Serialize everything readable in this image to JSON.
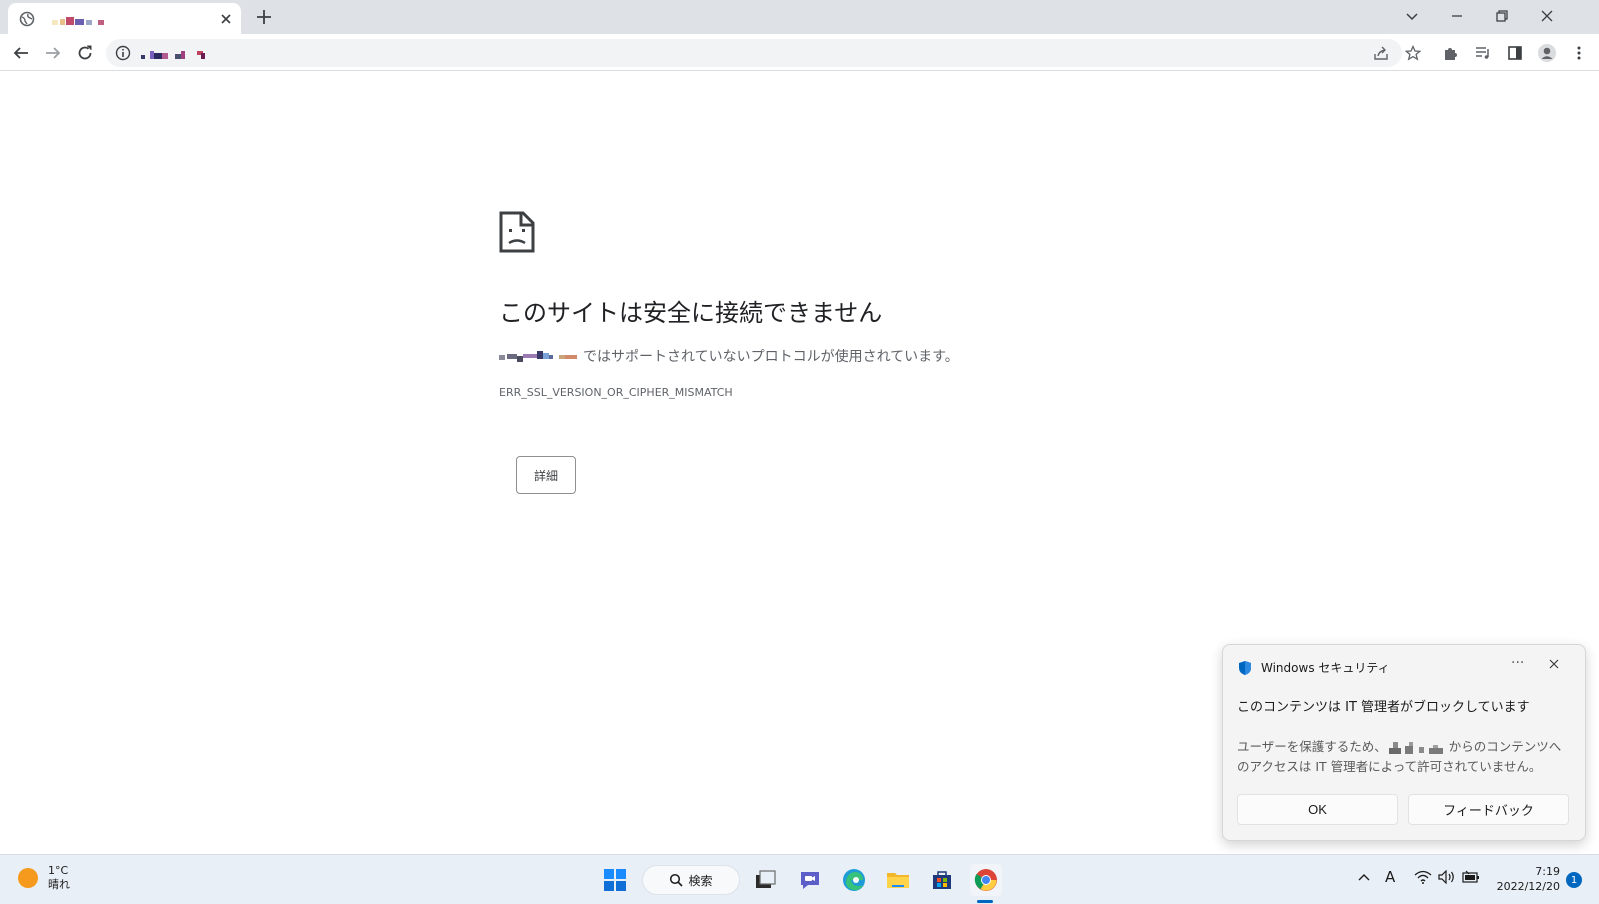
{
  "browser": {
    "tab": {
      "title_redacted": true
    },
    "window_controls": [
      "tab-search",
      "minimize",
      "restore",
      "close"
    ],
    "toolbar": {
      "url_redacted": true
    }
  },
  "error_page": {
    "title": "このサイトは安全に接続できません",
    "description": "ではサポートされていないプロトコルが使用されています。",
    "error_code": "ERR_SSL_VERSION_OR_CIPHER_MISMATCH",
    "details_button": "詳細"
  },
  "toast": {
    "app_name": "Windows セキュリティ",
    "more": "···",
    "title": "このコンテンツは IT 管理者がブロックしています",
    "body_prefix": "ユーザーを保護するため、",
    "body_suffix": "からのコンテンツへのアクセスは IT 管理者によって許可されていません。",
    "ok_button": "OK",
    "feedback_button": "フィードバック",
    "accent_color": "#0067c0"
  },
  "taskbar": {
    "weather": {
      "temp": "1°C",
      "condition": "晴れ"
    },
    "search_label": "検索",
    "apps": [
      "start-icon",
      "search",
      "task-view-icon",
      "chat-icon",
      "edge-icon",
      "file-explorer-icon",
      "store-icon",
      "chrome-icon"
    ],
    "clock": {
      "time": "7:19",
      "date": "2022/12/20"
    },
    "ime": "A",
    "notification_count": "1"
  }
}
